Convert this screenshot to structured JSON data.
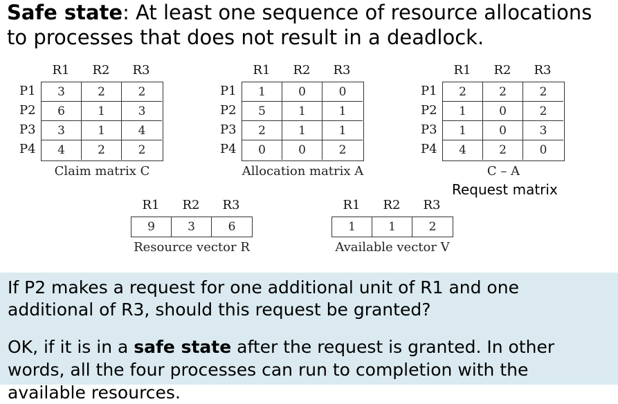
{
  "title": {
    "bold": "Safe state",
    "rest": ": At least one sequence of resource allocations to processes that does not result in a deadlock."
  },
  "columns": [
    "R1",
    "R2",
    "R3"
  ],
  "rows": [
    "P1",
    "P2",
    "P3",
    "P4"
  ],
  "claim_matrix": {
    "caption": "Claim matrix C",
    "values": [
      [
        "3",
        "2",
        "2"
      ],
      [
        "6",
        "1",
        "3"
      ],
      [
        "3",
        "1",
        "4"
      ],
      [
        "4",
        "2",
        "2"
      ]
    ]
  },
  "allocation_matrix": {
    "caption": "Allocation matrix A",
    "values": [
      [
        "1",
        "0",
        "0"
      ],
      [
        "5",
        "1",
        "1"
      ],
      [
        "2",
        "1",
        "1"
      ],
      [
        "0",
        "0",
        "2"
      ]
    ]
  },
  "ca_matrix": {
    "caption": "C – A",
    "label": "Request matrix",
    "values": [
      [
        "2",
        "2",
        "2"
      ],
      [
        "1",
        "0",
        "2"
      ],
      [
        "1",
        "0",
        "3"
      ],
      [
        "4",
        "2",
        "0"
      ]
    ]
  },
  "resource_vector": {
    "caption": "Resource vector R",
    "values": [
      "9",
      "3",
      "6"
    ]
  },
  "available_vector": {
    "caption": "Available vector V",
    "values": [
      "1",
      "1",
      "2"
    ]
  },
  "question": "If P2 makes a request for one additional unit of R1 and one additional of R3, should this request be granted?",
  "answer": {
    "prefix": "OK, if it is in a ",
    "bold": "safe state",
    "suffix": " after the request is granted. In other words, all the four processes can run to completion with the available resources."
  }
}
